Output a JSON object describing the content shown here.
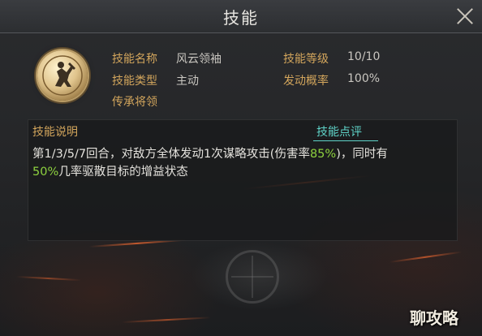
{
  "window": {
    "title": "技能"
  },
  "skill_info": {
    "name_label": "技能名称",
    "name_value": "风云领袖",
    "level_label": "技能等级",
    "level_value": "10/10",
    "type_label": "技能类型",
    "type_value": "主动",
    "chance_label": "发动概率",
    "chance_value": "100%",
    "inherit_label": "传承将领"
  },
  "description": {
    "title": "技能说明",
    "review_link": "技能点评",
    "line1_a": "第1/3/5/7回合，对敌方全体发动1次谋略攻击(伤害率",
    "line1_b": "85%",
    "line1_c": ")，同时有",
    "line2_a": "50%",
    "line2_b": "几率驱散目标的增益状态"
  },
  "icons": {
    "close": "close-icon",
    "skill": "skill-emblem-icon"
  },
  "colors": {
    "label": "#d2a55c",
    "highlight": "#8ed23f",
    "link": "#5fd3c8"
  },
  "watermark": "聊攻略"
}
